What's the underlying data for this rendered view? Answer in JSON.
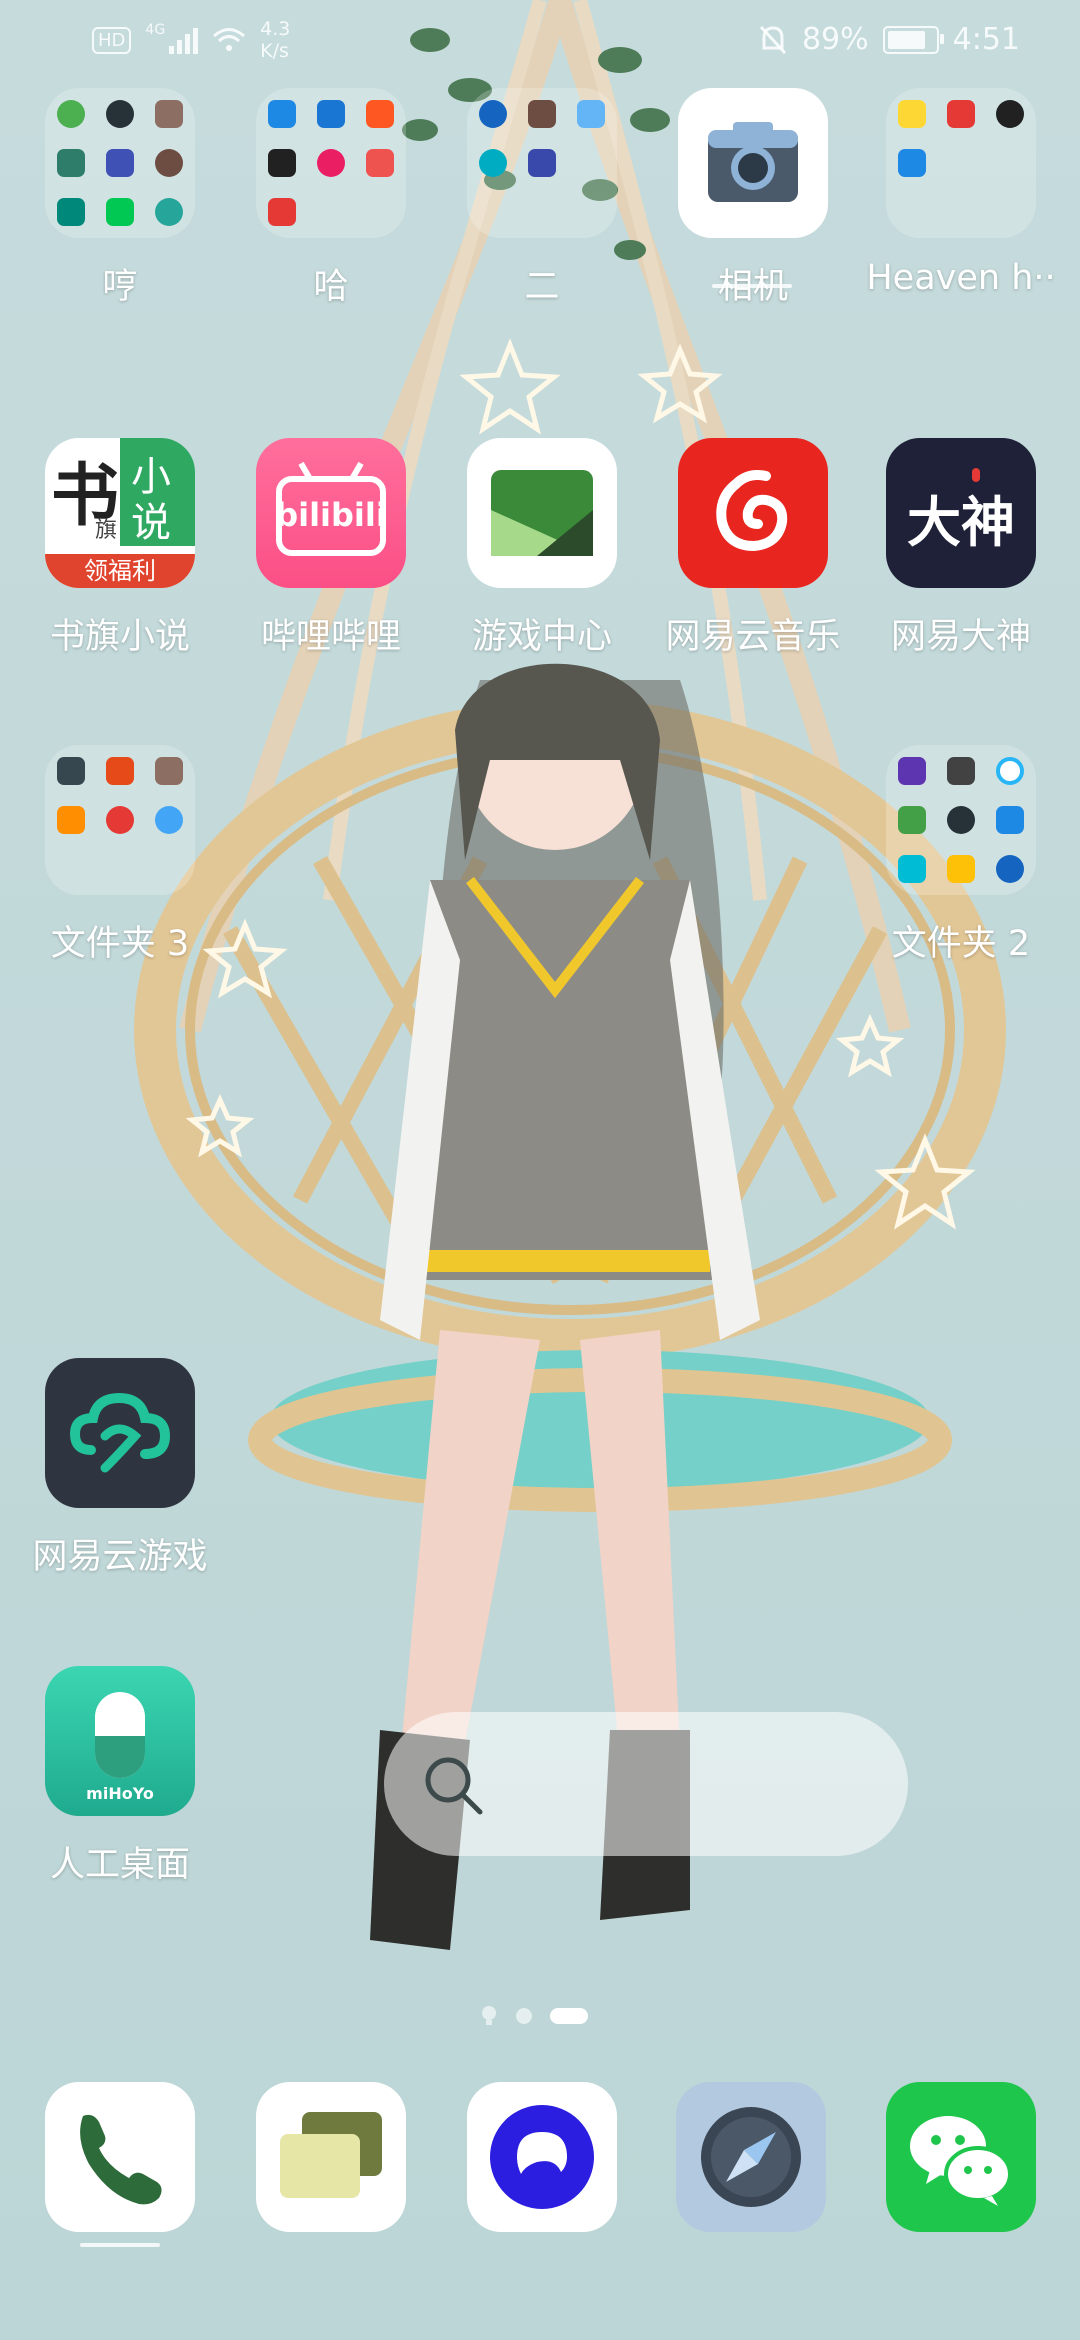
{
  "status_bar": {
    "hd_badge": "HD",
    "network_type": "4G",
    "net_speed_value": "4.3",
    "net_speed_unit": "K/s",
    "battery_percent": "89%",
    "battery_level": 0.89,
    "time": "4:51"
  },
  "home": {
    "row1": [
      {
        "label": "哼",
        "kind": "folder"
      },
      {
        "label": "哈",
        "kind": "folder"
      },
      {
        "label": "二",
        "kind": "folder"
      },
      {
        "label": "相机",
        "kind": "app",
        "icon": "camera-icon"
      },
      {
        "label": "Heaven h··",
        "kind": "folder"
      }
    ],
    "row2": [
      {
        "label": "书旗小说",
        "icon": "shuqi-novel-icon",
        "icon_text_1": "书",
        "icon_text_2": "小",
        "icon_text_3": "说",
        "icon_text_4": "旗",
        "icon_text_5": "领福利"
      },
      {
        "label": "哔哩哔哩",
        "icon": "bilibili-icon",
        "icon_text": "bilibili"
      },
      {
        "label": "游戏中心",
        "icon": "game-center-icon"
      },
      {
        "label": "网易云音乐",
        "icon": "netease-music-icon"
      },
      {
        "label": "网易大神",
        "icon": "netease-dashen-icon",
        "icon_text": "大神"
      }
    ],
    "row3": [
      {
        "label": "文件夹 3",
        "kind": "folder"
      },
      {
        "label": "文件夹 2",
        "kind": "folder"
      }
    ],
    "cloud_game": {
      "label": "网易云游戏",
      "icon": "netease-cloud-game-icon"
    },
    "ai_desktop": {
      "label": "人工桌面",
      "icon": "mihoyo-icon",
      "icon_text": "miHoYo"
    },
    "search_icon": "search-icon",
    "page_indicator": {
      "pages": 3,
      "current": 3
    }
  },
  "dock": [
    {
      "name": "phone",
      "icon": "phone-icon"
    },
    {
      "name": "messages",
      "icon": "messages-icon"
    },
    {
      "name": "browser",
      "icon": "browser-icon"
    },
    {
      "name": "compass",
      "icon": "compass-icon"
    },
    {
      "name": "wechat",
      "icon": "wechat-icon"
    }
  ]
}
